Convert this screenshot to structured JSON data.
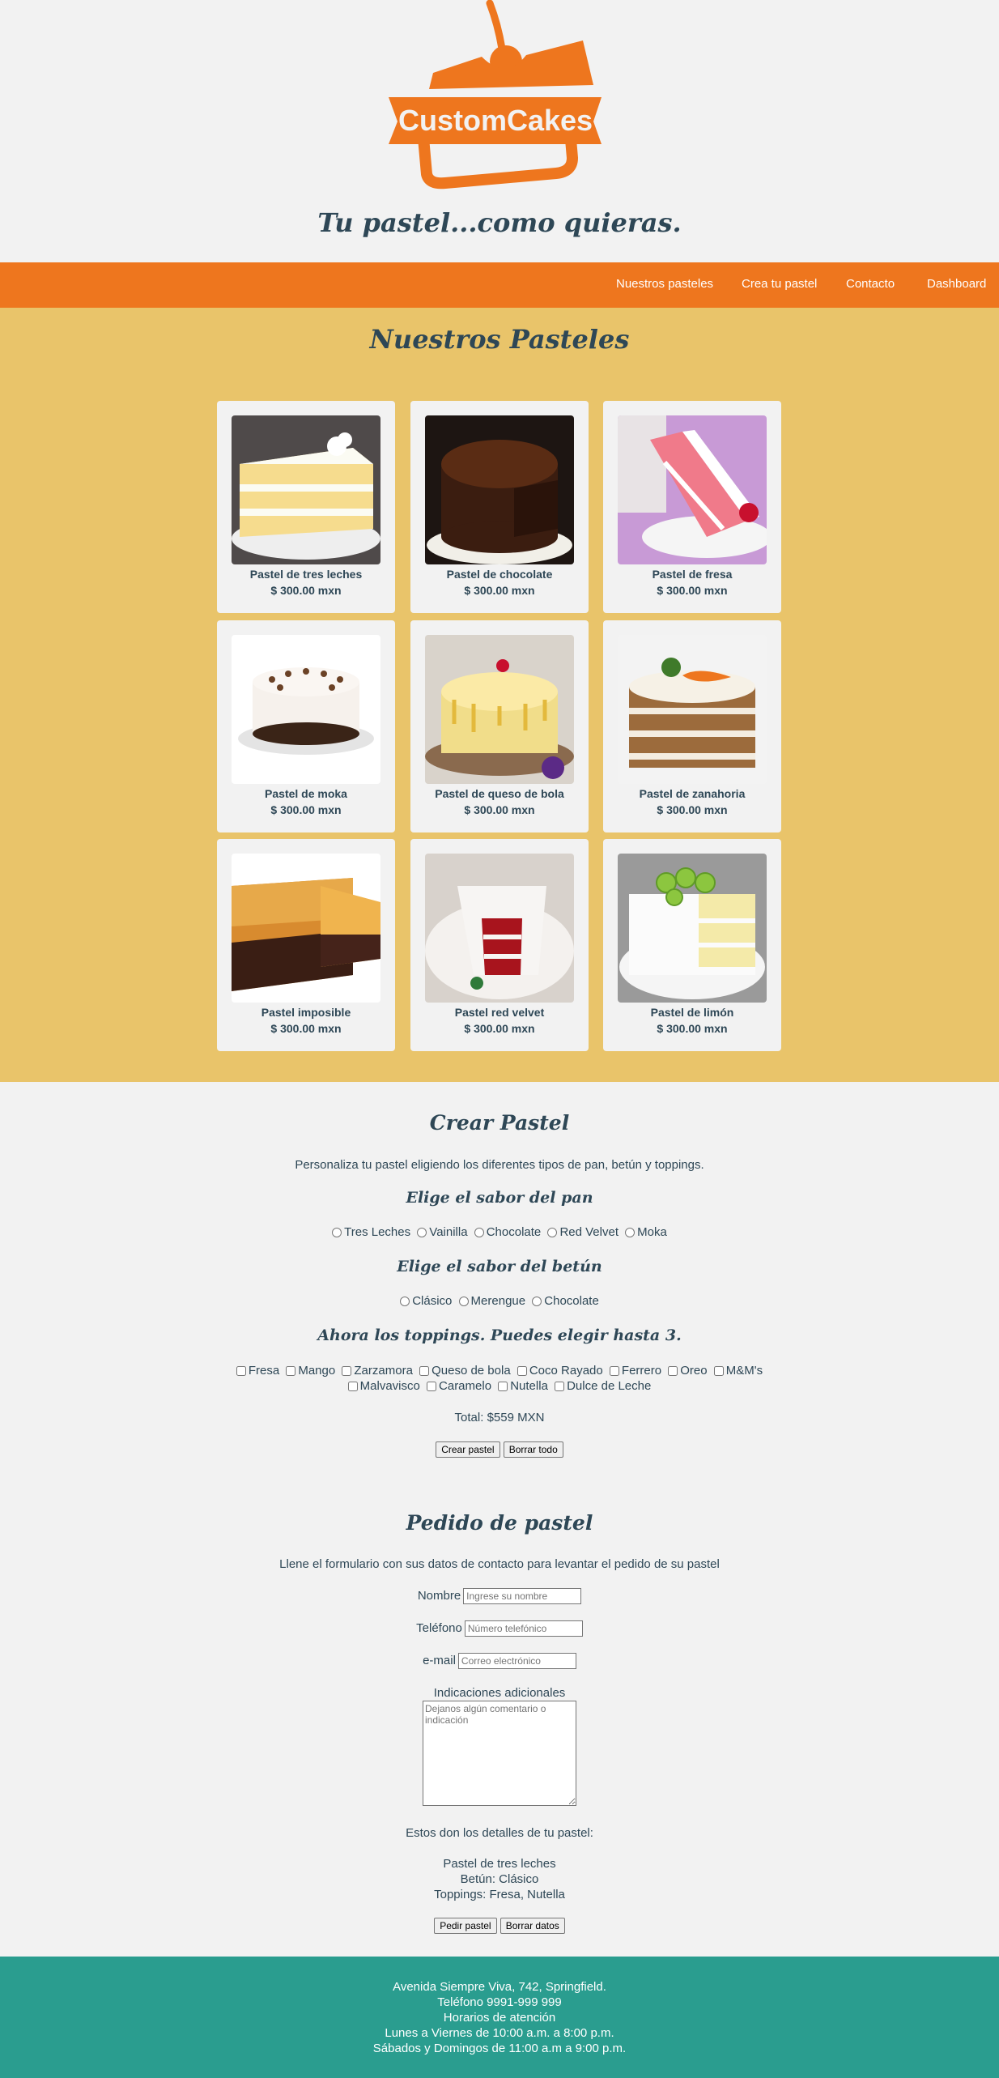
{
  "brand": {
    "logo_text": "CustomCakes",
    "tagline": "Tu pastel...como quieras.",
    "accent": "#ee761e",
    "text_color": "#2e4756"
  },
  "nav": {
    "items": [
      "Nuestros pasteles",
      "Crea tu pastel",
      "Contacto",
      "Dashboard"
    ],
    "background": "#ee761e"
  },
  "cakes": {
    "title": "Nuestros Pasteles",
    "background": "#e9c46a",
    "items": [
      {
        "name": "Pastel de tres leches",
        "price": "$ 300.00 mxn",
        "image": "tres-leches-cake-image"
      },
      {
        "name": "Pastel de chocolate",
        "price": "$ 300.00 mxn",
        "image": "chocolate-cake-image"
      },
      {
        "name": "Pastel de fresa",
        "price": "$ 300.00 mxn",
        "image": "strawberry-cake-image"
      },
      {
        "name": "Pastel de moka",
        "price": "$ 300.00 mxn",
        "image": "moka-cake-image"
      },
      {
        "name": "Pastel de queso de bola",
        "price": "$ 300.00 mxn",
        "image": "queso-de-bola-cake-image"
      },
      {
        "name": "Pastel de zanahoria",
        "price": "$ 300.00 mxn",
        "image": "carrot-cake-image"
      },
      {
        "name": "Pastel imposible",
        "price": "$ 300.00 mxn",
        "image": "imposible-cake-image"
      },
      {
        "name": "Pastel red velvet",
        "price": "$ 300.00 mxn",
        "image": "red-velvet-cake-image"
      },
      {
        "name": "Pastel de limón",
        "price": "$ 300.00 mxn",
        "image": "lemon-cake-image"
      }
    ]
  },
  "builder": {
    "title": "Crear Pastel",
    "description": "Personaliza tu pastel eligiendo los diferentes tipos de pan, betún y toppings.",
    "bread_title": "Elige el sabor del pan",
    "bread_options": [
      "Tres Leches",
      "Vainilla",
      "Chocolate",
      "Red Velvet",
      "Moka"
    ],
    "frosting_title": "Elige el sabor del betún",
    "frosting_options": [
      "Clásico",
      "Merengue",
      "Chocolate"
    ],
    "toppings_title": "Ahora los toppings. Puedes elegir hasta 3.",
    "toppings_row1": [
      "Fresa",
      "Mango",
      "Zarzamora",
      "Queso de bola",
      "Coco Rayado",
      "Ferrero",
      "Oreo",
      "M&M's"
    ],
    "toppings_row2": [
      "Malvavisco",
      "Caramelo",
      "Nutella",
      "Dulce de Leche"
    ],
    "total": "Total: $559 MXN",
    "create_button": "Crear pastel",
    "clear_button": "Borrar todo"
  },
  "order": {
    "title": "Pedido de pastel",
    "description": "Llene el formulario con sus datos de contacto para levantar el pedido de su pastel",
    "name_label": "Nombre",
    "name_placeholder": "Ingrese su nombre",
    "phone_label": "Teléfono",
    "phone_placeholder": "Número telefónico",
    "email_label": "e-mail",
    "email_placeholder": "Correo electrónico",
    "notes_label": "Indicaciones adicionales",
    "notes_placeholder": "Dejanos algún comentario o indicación",
    "details_intro": "Estos don los detalles de tu pastel:",
    "detail_cake": "Pastel de tres leches",
    "detail_frosting": "Betún: Clásico",
    "detail_toppings": "Toppings: Fresa, Nutella",
    "order_button": "Pedir pastel",
    "clear_button": "Borrar datos"
  },
  "footer": {
    "background": "#2a9d8f",
    "lines": [
      "Avenida Siempre Viva, 742, Springfield.",
      "Teléfono 9991-999 999",
      "Horarios de atención",
      "Lunes a Viernes de 10:00 a.m. a 8:00 p.m.",
      "Sábados y Domingos de 11:00 a.m a 9:00 p.m."
    ]
  }
}
